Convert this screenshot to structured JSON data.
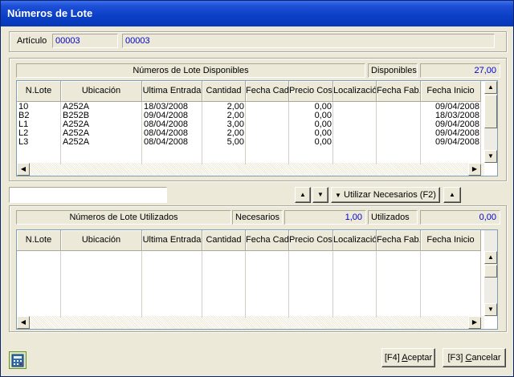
{
  "window": {
    "title": "Números de Lote"
  },
  "articulo": {
    "label": "Artículo",
    "code": "00003",
    "description": "00003"
  },
  "disponibles_panel": {
    "title": "Números de Lote Disponibles",
    "count_label": "Disponibles",
    "count_value": "27,00"
  },
  "columns": [
    "N.Lote",
    "Ubicación",
    "Ultima Entrada",
    "Cantidad",
    "Fecha Cad",
    "Precio Coste",
    "Localización",
    "Fecha Fab.",
    "Fecha Inicio"
  ],
  "disponibles_rows": [
    [
      "10",
      "A252A",
      "18/03/2008",
      "2,00",
      "",
      "0,00",
      "",
      "",
      "09/04/2008"
    ],
    [
      "B2",
      "B252B",
      "09/04/2008",
      "2,00",
      "",
      "0,00",
      "",
      "",
      "18/03/2008"
    ],
    [
      "L1",
      "A252A",
      "08/04/2008",
      "3,00",
      "",
      "0,00",
      "",
      "",
      "09/04/2008"
    ],
    [
      "L2",
      "A252A",
      "08/04/2008",
      "2,00",
      "",
      "0,00",
      "",
      "",
      "09/04/2008"
    ],
    [
      "L3",
      "A252A",
      "08/04/2008",
      "5,00",
      "",
      "0,00",
      "",
      "",
      "09/04/2008"
    ]
  ],
  "middle": {
    "search_value": "",
    "up_glyph": "▲",
    "down_glyph": "▼",
    "utilizar_label": "Utilizar Necesarios (F2)"
  },
  "utilizados_panel": {
    "title": "Números de Lote Utilizados",
    "necesarios_label": "Necesarios",
    "necesarios_value": "1,00",
    "utilizados_label": "Utilizados",
    "utilizados_value": "0,00"
  },
  "footer": {
    "aceptar_key": "[F4] ",
    "aceptar_underlined": "A",
    "aceptar_rest": "ceptar",
    "cancelar_key": "[F3] ",
    "cancelar_underlined": "C",
    "cancelar_rest": "ancelar",
    "icon": "calculator-icon"
  },
  "colors": {
    "title_blue": "#0a3fc6",
    "value_blue": "#0000cc",
    "background": "#ece9d8"
  }
}
